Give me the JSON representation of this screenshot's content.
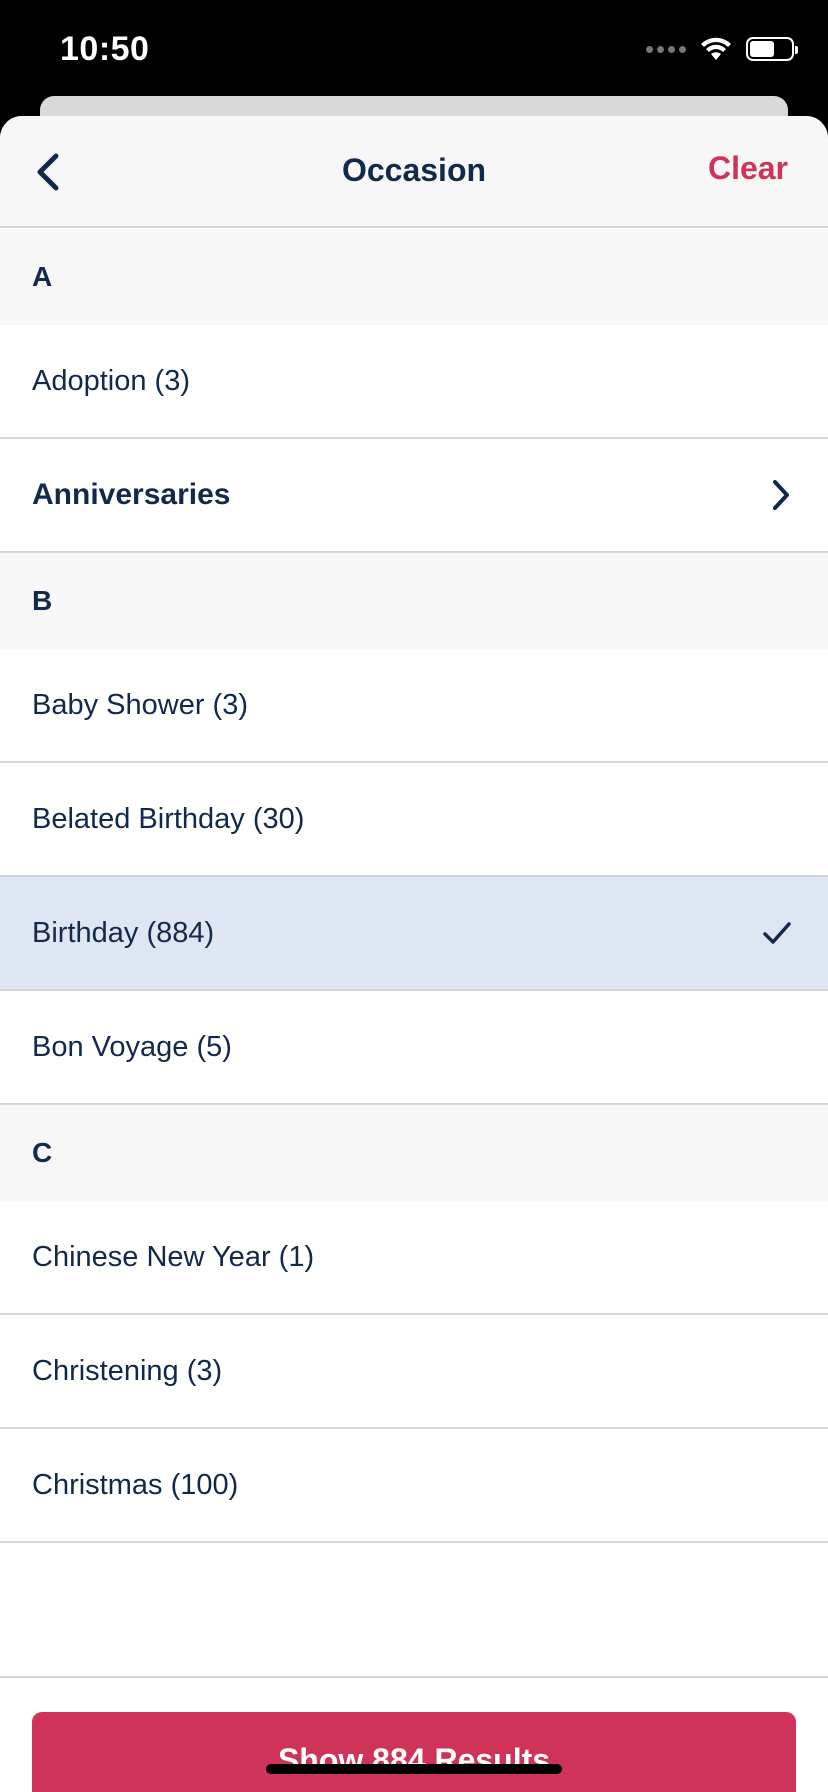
{
  "status_bar": {
    "time": "10:50"
  },
  "header": {
    "title": "Occasion",
    "clear_label": "Clear"
  },
  "list": [
    {
      "type": "section",
      "label": "A"
    },
    {
      "type": "item",
      "label": "Adoption (3)"
    },
    {
      "type": "category",
      "label": "Anniversaries"
    },
    {
      "type": "section",
      "label": "B"
    },
    {
      "type": "item",
      "label": "Baby Shower (3)"
    },
    {
      "type": "item",
      "label": "Belated Birthday (30)"
    },
    {
      "type": "item",
      "label": "Birthday (884)",
      "selected": true
    },
    {
      "type": "item",
      "label": "Bon Voyage (5)"
    },
    {
      "type": "section",
      "label": "C"
    },
    {
      "type": "item",
      "label": "Chinese New Year (1)"
    },
    {
      "type": "item",
      "label": "Christening (3)"
    },
    {
      "type": "item",
      "label": "Christmas (100)"
    }
  ],
  "footer": {
    "button_label": "Show 884 Results"
  },
  "colors": {
    "accent": "#cf3458",
    "text": "#13294b",
    "selected_bg": "#dfe6f3"
  },
  "icons": [
    "back-chevron-icon",
    "chevron-right-icon",
    "checkmark-icon",
    "wifi-icon",
    "battery-icon"
  ]
}
